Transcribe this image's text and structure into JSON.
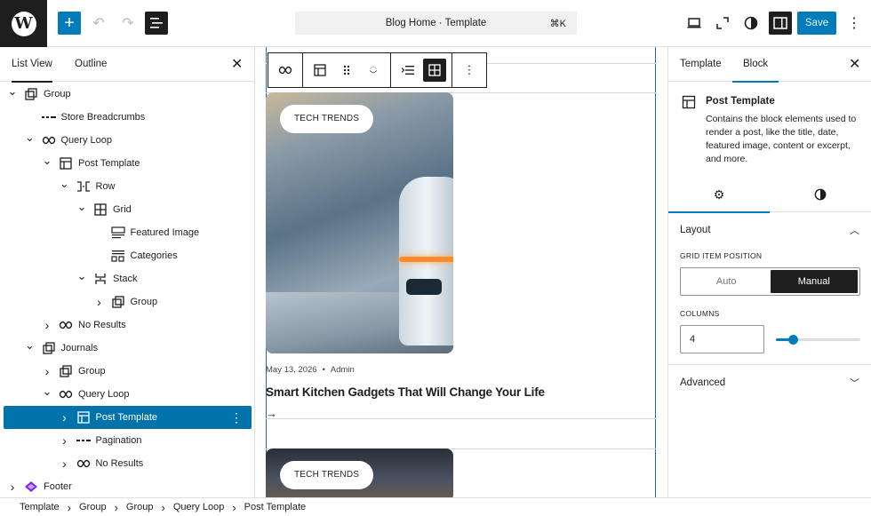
{
  "topbar": {
    "logo": "W",
    "add_icon": "+",
    "undo_icon": "↶",
    "redo_icon": "↷",
    "document_title": "Blog Home · Template",
    "shortcut": "⌘K",
    "save_label": "Save",
    "more_icon": "⋮"
  },
  "left_panel": {
    "tabs": [
      "List View",
      "Outline"
    ],
    "active_tab": "List View",
    "close_icon": "✕",
    "tree": [
      {
        "label": "Group",
        "icon": "group-icon",
        "depth": 0,
        "chevron": "down"
      },
      {
        "label": "Store Breadcrumbs",
        "icon": "breadcrumbs-icon",
        "depth": 1,
        "chevron": ""
      },
      {
        "label": "Query Loop",
        "icon": "loop-icon",
        "depth": 1,
        "chevron": "down"
      },
      {
        "label": "Post Template",
        "icon": "layout-icon",
        "depth": 2,
        "chevron": "down"
      },
      {
        "label": "Row",
        "icon": "row-icon",
        "depth": 3,
        "chevron": "down"
      },
      {
        "label": "Grid",
        "icon": "grid-icon",
        "depth": 4,
        "chevron": "down"
      },
      {
        "label": "Featured Image",
        "icon": "featured-image-icon",
        "depth": 5,
        "chevron": ""
      },
      {
        "label": "Categories",
        "icon": "categories-icon",
        "depth": 5,
        "chevron": ""
      },
      {
        "label": "Stack",
        "icon": "stack-icon",
        "depth": 4,
        "chevron": "down"
      },
      {
        "label": "Group",
        "icon": "group-icon",
        "depth": 5,
        "chevron": "right"
      },
      {
        "label": "No Results",
        "icon": "loop-icon",
        "depth": 2,
        "chevron": "right"
      },
      {
        "label": "Journals",
        "icon": "group-icon",
        "depth": 1,
        "chevron": "down"
      },
      {
        "label": "Group",
        "icon": "group-icon",
        "depth": 2,
        "chevron": "right"
      },
      {
        "label": "Query Loop",
        "icon": "loop-icon",
        "depth": 2,
        "chevron": "down"
      },
      {
        "label": "Post Template",
        "icon": "layout-icon",
        "depth": 3,
        "chevron": "right",
        "selected": true
      },
      {
        "label": "Pagination",
        "icon": "pagination-icon",
        "depth": 3,
        "chevron": "right"
      },
      {
        "label": "No Results",
        "icon": "loop-icon",
        "depth": 3,
        "chevron": "right"
      },
      {
        "label": "Footer",
        "icon": "footer-icon",
        "depth": 0,
        "chevron": "right"
      }
    ]
  },
  "canvas": {
    "posts": [
      {
        "category": "TECH TRENDS",
        "date": "May 13, 2026",
        "author": "Admin",
        "title": "Smart Kitchen Gadgets That Will Change Your Life",
        "arrow": "→"
      },
      {
        "category": "TECH TRENDS"
      }
    ],
    "meta_separator": "•"
  },
  "right_panel": {
    "tabs": [
      "Template",
      "Block"
    ],
    "active_tab": "Block",
    "close_icon": "✕",
    "block": {
      "name": "Post Template",
      "description": "Contains the block elements used to render a post, like the title, date, featured image, content or excerpt, and more."
    },
    "layout": {
      "title": "Layout",
      "grid_item_position_label": "GRID ITEM POSITION",
      "options": [
        "Auto",
        "Manual"
      ],
      "selected_option": "Manual",
      "columns_label": "COLUMNS",
      "columns_value": "4",
      "columns_slider_fraction": 0.2
    },
    "advanced": {
      "title": "Advanced"
    }
  },
  "breadcrumbs": [
    "Template",
    "Group",
    "Group",
    "Query Loop",
    "Post Template"
  ],
  "colors": {
    "accent": "#007cba",
    "dark": "#1e1e1e",
    "footer_icon": "#7b2cff"
  }
}
